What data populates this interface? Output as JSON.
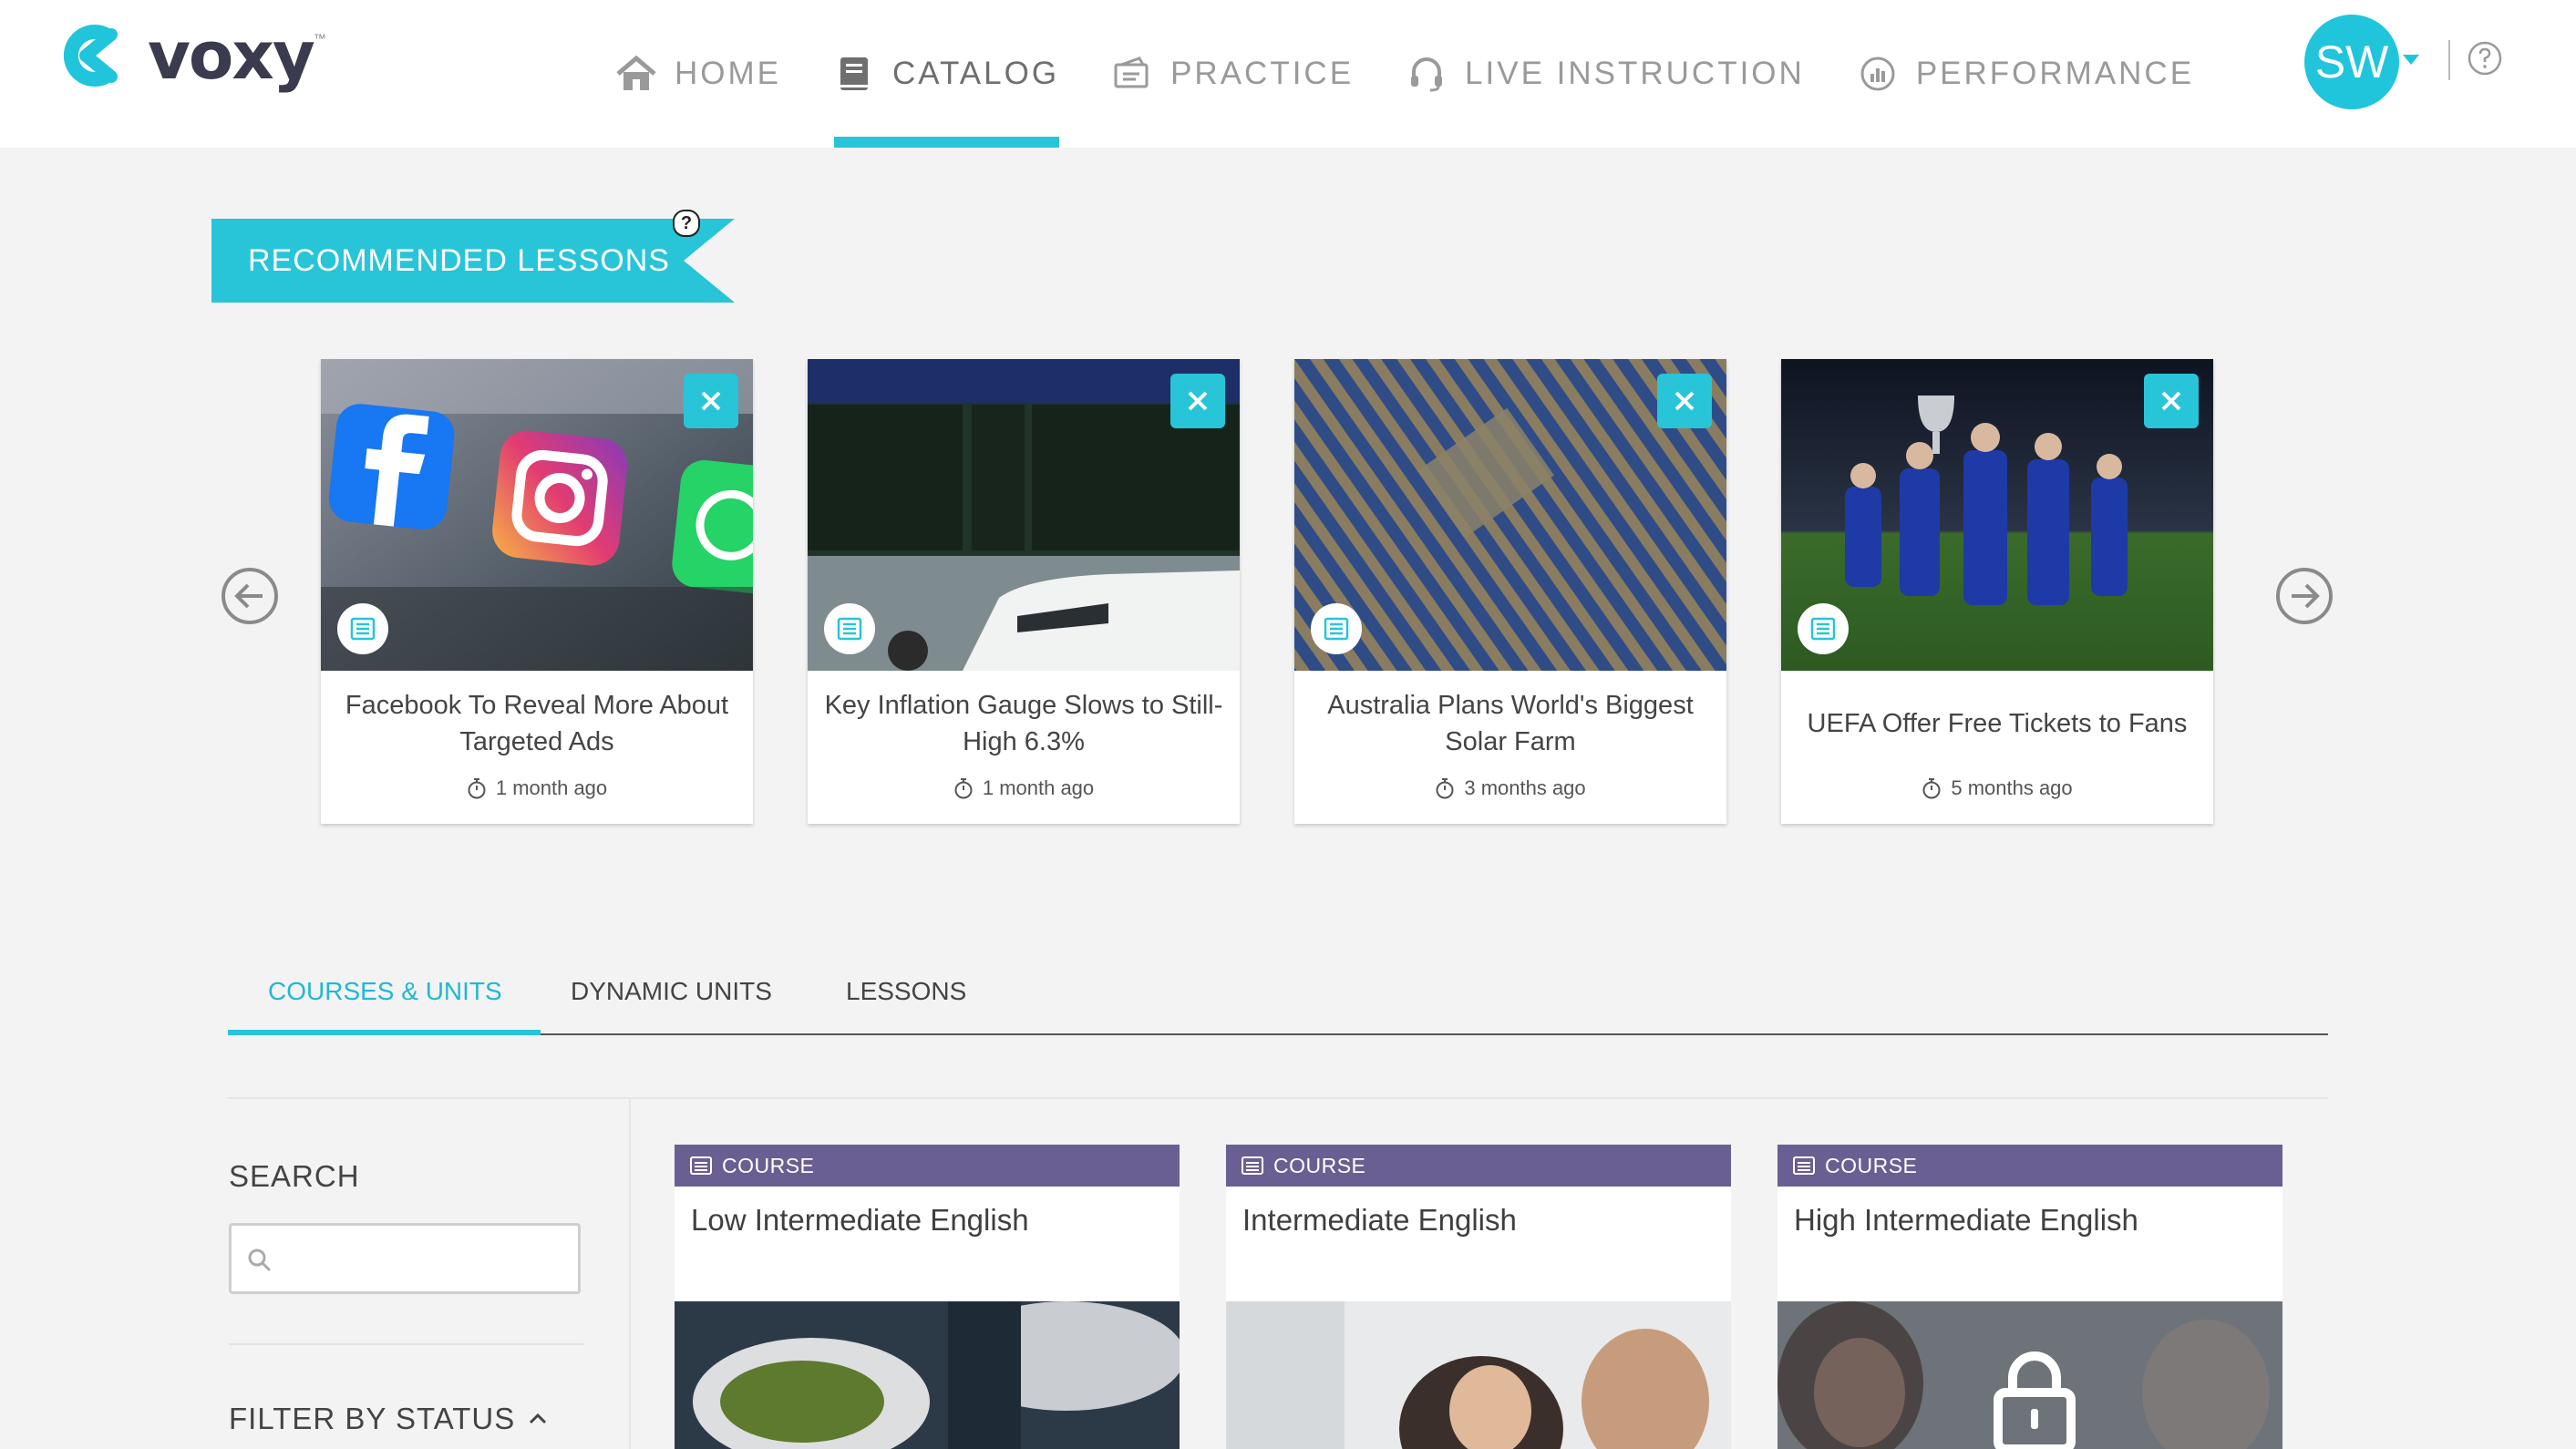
{
  "header": {
    "logo_text": "voxy",
    "logo_tm": "™",
    "nav": [
      {
        "label": "HOME",
        "icon": "home-icon"
      },
      {
        "label": "CATALOG",
        "icon": "book-icon"
      },
      {
        "label": "PRACTICE",
        "icon": "ticket-icon"
      },
      {
        "label": "LIVE INSTRUCTION",
        "icon": "headset-icon"
      },
      {
        "label": "PERFORMANCE",
        "icon": "chart-icon"
      }
    ],
    "active_nav": "CATALOG",
    "user_initials": "SW"
  },
  "recommended": {
    "title": "RECOMMENDED LESSONS",
    "help_label": "?",
    "cards": [
      {
        "title": "Facebook To Reveal More About Targeted Ads",
        "time": "1 month ago",
        "image": "social-media-apps-photo"
      },
      {
        "title": "Key Inflation Gauge Slows to Still-High 6.3%",
        "time": "1 month ago",
        "image": "gas-station-price-sign-photo"
      },
      {
        "title": "Australia Plans World's Biggest Solar Farm",
        "time": "3 months ago",
        "image": "solar-farm-aerial-photo"
      },
      {
        "title": "UEFA Offer Free Tickets to Fans",
        "time": "5 months ago",
        "image": "football-team-trophy-photo"
      }
    ]
  },
  "tabs": [
    {
      "label": "COURSES & UNITS",
      "active": true
    },
    {
      "label": "DYNAMIC UNITS",
      "active": false
    },
    {
      "label": "LESSONS",
      "active": false
    }
  ],
  "sidebar": {
    "search_label": "SEARCH",
    "search_value": "",
    "filter_label": "FILTER BY STATUS"
  },
  "courses": [
    {
      "type": "COURSE",
      "title": "Low Intermediate English",
      "image": "food-photo",
      "locked": false
    },
    {
      "type": "COURSE",
      "title": "Intermediate English",
      "image": "people-meeting-photo",
      "locked": false
    },
    {
      "type": "COURSE",
      "title": "High Intermediate English",
      "image": "smiling-woman-photo",
      "locked": true
    }
  ],
  "colors": {
    "accent": "#28c4d8",
    "course_header": "#6a5f92",
    "background": "#f3f3f3"
  }
}
